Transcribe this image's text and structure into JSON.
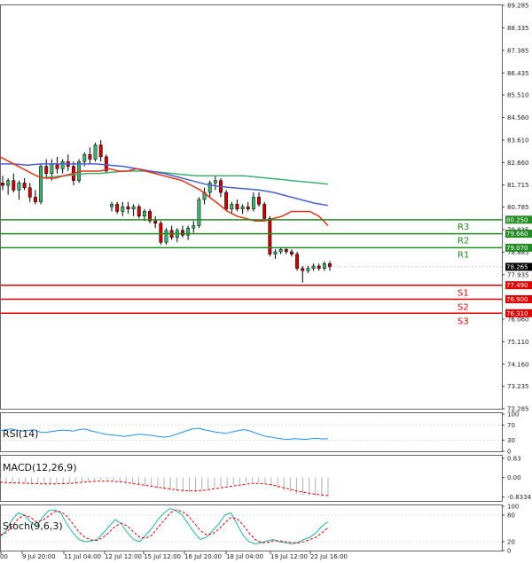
{
  "chart_data": {
    "type": "candlestick",
    "main": {
      "y_ticks": [
        "89.285",
        "88.335",
        "87.385",
        "86.435",
        "85.510",
        "84.560",
        "83.610",
        "82.660",
        "81.715",
        "80.785",
        "79.835",
        "78.885",
        "77.935",
        "76.060",
        "75.110",
        "74.160",
        "73.235",
        "72.285"
      ],
      "ylim": [
        72.285,
        89.285
      ],
      "last_price": "78.265",
      "candles": [
        {
          "o": 81.8,
          "h": 82.1,
          "l": 81.5,
          "c": 81.7
        },
        {
          "o": 81.7,
          "h": 82.0,
          "l": 81.3,
          "c": 81.9
        },
        {
          "o": 81.9,
          "h": 82.2,
          "l": 81.4,
          "c": 81.5
        },
        {
          "o": 81.5,
          "h": 81.9,
          "l": 81.1,
          "c": 81.8
        },
        {
          "o": 81.8,
          "h": 82.0,
          "l": 81.5,
          "c": 81.6
        },
        {
          "o": 81.6,
          "h": 81.8,
          "l": 81.0,
          "c": 81.2
        },
        {
          "o": 81.2,
          "h": 81.5,
          "l": 80.9,
          "c": 81.0
        },
        {
          "o": 81.0,
          "h": 82.6,
          "l": 80.9,
          "c": 82.5
        },
        {
          "o": 82.5,
          "h": 82.8,
          "l": 82.0,
          "c": 82.2
        },
        {
          "o": 82.2,
          "h": 82.8,
          "l": 81.9,
          "c": 82.6
        },
        {
          "o": 82.6,
          "h": 82.9,
          "l": 82.2,
          "c": 82.4
        },
        {
          "o": 82.4,
          "h": 82.8,
          "l": 82.2,
          "c": 82.7
        },
        {
          "o": 82.7,
          "h": 83.0,
          "l": 82.3,
          "c": 82.5
        },
        {
          "o": 82.5,
          "h": 82.7,
          "l": 81.7,
          "c": 81.9
        },
        {
          "o": 81.9,
          "h": 82.8,
          "l": 81.8,
          "c": 82.7
        },
        {
          "o": 82.7,
          "h": 83.1,
          "l": 82.5,
          "c": 83.0
        },
        {
          "o": 83.0,
          "h": 83.3,
          "l": 82.6,
          "c": 82.8
        },
        {
          "o": 82.8,
          "h": 83.5,
          "l": 82.7,
          "c": 83.4
        },
        {
          "o": 83.4,
          "h": 83.6,
          "l": 82.7,
          "c": 82.9
        },
        {
          "o": 82.9,
          "h": 83.0,
          "l": 82.2,
          "c": 82.3
        },
        {
          "o": 80.8,
          "h": 81.0,
          "l": 80.6,
          "c": 80.9
        },
        {
          "o": 80.9,
          "h": 81.0,
          "l": 80.5,
          "c": 80.6
        },
        {
          "o": 80.6,
          "h": 81.0,
          "l": 80.4,
          "c": 80.8
        },
        {
          "o": 80.8,
          "h": 81.0,
          "l": 80.5,
          "c": 80.7
        },
        {
          "o": 80.7,
          "h": 80.9,
          "l": 80.4,
          "c": 80.8
        },
        {
          "o": 80.8,
          "h": 80.9,
          "l": 80.3,
          "c": 80.4
        },
        {
          "o": 80.4,
          "h": 80.7,
          "l": 80.2,
          "c": 80.6
        },
        {
          "o": 80.6,
          "h": 80.7,
          "l": 80.1,
          "c": 80.2
        },
        {
          "o": 80.2,
          "h": 80.4,
          "l": 79.9,
          "c": 80.1
        },
        {
          "o": 80.1,
          "h": 80.2,
          "l": 79.2,
          "c": 79.3
        },
        {
          "o": 79.3,
          "h": 79.9,
          "l": 79.2,
          "c": 79.8
        },
        {
          "o": 79.8,
          "h": 80.0,
          "l": 79.4,
          "c": 79.5
        },
        {
          "o": 79.5,
          "h": 79.9,
          "l": 79.3,
          "c": 79.8
        },
        {
          "o": 79.8,
          "h": 80.0,
          "l": 79.5,
          "c": 79.6
        },
        {
          "o": 79.6,
          "h": 80.0,
          "l": 79.4,
          "c": 79.9
        },
        {
          "o": 79.9,
          "h": 80.2,
          "l": 79.7,
          "c": 80.0
        },
        {
          "o": 80.0,
          "h": 81.2,
          "l": 79.9,
          "c": 81.1
        },
        {
          "o": 81.1,
          "h": 81.6,
          "l": 80.9,
          "c": 81.4
        },
        {
          "o": 81.4,
          "h": 81.9,
          "l": 81.2,
          "c": 81.8
        },
        {
          "o": 81.8,
          "h": 82.1,
          "l": 81.5,
          "c": 81.9
        },
        {
          "o": 81.9,
          "h": 82.0,
          "l": 81.2,
          "c": 81.4
        },
        {
          "o": 81.4,
          "h": 81.5,
          "l": 80.6,
          "c": 80.7
        },
        {
          "o": 80.7,
          "h": 81.0,
          "l": 80.5,
          "c": 80.9
        },
        {
          "o": 80.9,
          "h": 81.1,
          "l": 80.6,
          "c": 80.7
        },
        {
          "o": 80.7,
          "h": 80.9,
          "l": 80.5,
          "c": 80.8
        },
        {
          "o": 80.8,
          "h": 81.0,
          "l": 80.6,
          "c": 80.7
        },
        {
          "o": 80.7,
          "h": 81.4,
          "l": 80.6,
          "c": 81.2
        },
        {
          "o": 81.2,
          "h": 81.4,
          "l": 80.8,
          "c": 80.9
        },
        {
          "o": 80.9,
          "h": 81.0,
          "l": 80.2,
          "c": 80.3
        },
        {
          "o": 80.3,
          "h": 80.4,
          "l": 78.7,
          "c": 78.8
        },
        {
          "o": 78.8,
          "h": 79.0,
          "l": 78.6,
          "c": 78.9
        },
        {
          "o": 78.9,
          "h": 79.1,
          "l": 78.8,
          "c": 79.0
        },
        {
          "o": 79.0,
          "h": 79.1,
          "l": 78.8,
          "c": 78.9
        },
        {
          "o": 78.9,
          "h": 79.0,
          "l": 78.7,
          "c": 78.8
        },
        {
          "o": 78.8,
          "h": 78.9,
          "l": 78.1,
          "c": 78.2
        },
        {
          "o": 78.2,
          "h": 78.3,
          "l": 77.6,
          "c": 78.1
        },
        {
          "o": 78.1,
          "h": 78.3,
          "l": 78.0,
          "c": 78.2
        },
        {
          "o": 78.2,
          "h": 78.4,
          "l": 78.1,
          "c": 78.3
        },
        {
          "o": 78.3,
          "h": 78.4,
          "l": 78.1,
          "c": 78.2
        },
        {
          "o": 78.2,
          "h": 78.5,
          "l": 78.1,
          "c": 78.4
        },
        {
          "o": 78.4,
          "h": 78.5,
          "l": 78.1,
          "c": 78.265
        }
      ],
      "ma_fast": [
        82.9,
        82.7,
        82.5,
        82.3,
        82.1,
        82.0,
        82.0,
        82.1,
        82.2,
        82.3,
        82.3,
        82.3,
        82.4,
        82.3,
        82.3,
        82.4,
        82.3,
        82.2,
        82.1,
        82.0,
        81.9,
        81.7,
        81.5,
        81.2,
        80.9,
        80.6,
        80.4,
        80.3,
        80.2,
        80.2,
        80.3,
        80.4,
        80.6,
        80.6,
        80.6,
        80.4,
        80.0
      ],
      "ma_mid": [
        82.6,
        82.6,
        82.55,
        82.6,
        82.6,
        82.6,
        82.6,
        82.6,
        82.55,
        82.5,
        82.4,
        82.3,
        82.2,
        82.05,
        81.9,
        81.75,
        81.65,
        81.6,
        81.55,
        81.5,
        81.4,
        81.25,
        81.1,
        80.95,
        80.85
      ],
      "ma_slow": [
        82.0,
        82.05,
        82.1,
        82.15,
        82.2,
        82.2,
        82.25,
        82.3,
        82.3,
        82.3,
        82.25,
        82.2,
        82.15,
        82.1,
        82.1,
        82.1,
        82.1,
        82.1,
        82.05,
        82.0,
        81.95,
        81.9,
        81.85,
        81.8,
        81.75
      ],
      "levels": [
        {
          "name": "R3",
          "value": "80.250",
          "kind": "resistance"
        },
        {
          "name": "R2",
          "value": "79.660",
          "kind": "resistance"
        },
        {
          "name": "R1",
          "value": "79.070",
          "kind": "resistance"
        },
        {
          "name": "S1",
          "value": "77.490",
          "kind": "support"
        },
        {
          "name": "S2",
          "value": "76.900",
          "kind": "support"
        },
        {
          "name": "S3",
          "value": "76.310",
          "kind": "support"
        }
      ]
    },
    "x_ticks": [
      "00",
      "9 Jul 20:00",
      "11 Jul 04:00",
      "12 Jul 12:00",
      "15 Jul 12:00",
      "16 Jul 20:00",
      "18 Jul 04:00",
      "19 Jul 12:00",
      "22 Jul 16:00"
    ],
    "rsi": {
      "label": "RSI(14)",
      "ticks": [
        "100",
        "70",
        "30",
        "0"
      ],
      "ylim": [
        0,
        100
      ],
      "values": [
        55,
        58,
        60,
        57,
        54,
        56,
        58,
        52,
        50,
        53,
        55,
        57,
        56,
        54,
        58,
        60,
        55,
        52,
        48,
        45,
        44,
        42,
        40,
        42,
        45,
        46,
        44,
        42,
        40,
        38,
        40,
        45,
        50,
        55,
        60,
        62,
        58,
        55,
        52,
        50,
        48,
        52,
        55,
        58,
        56,
        50,
        45,
        40,
        38,
        35,
        33,
        32,
        34,
        33,
        32,
        34,
        35,
        33,
        34
      ]
    },
    "macd": {
      "label": "MACD(12,26,9)",
      "ticks": [
        "0.83",
        "0.00",
        "-0.8334"
      ],
      "ylim": [
        -1.0,
        0.9
      ],
      "hist": [
        -0.15,
        -0.18,
        -0.2,
        -0.22,
        -0.24,
        -0.25,
        -0.26,
        -0.27,
        -0.28,
        -0.28,
        -0.27,
        -0.25,
        -0.22,
        -0.18,
        -0.15,
        -0.12,
        -0.1,
        -0.1,
        -0.12,
        -0.15,
        -0.2,
        -0.25,
        -0.3,
        -0.35,
        -0.4,
        -0.45,
        -0.5,
        -0.55,
        -0.58,
        -0.6,
        -0.62,
        -0.6,
        -0.55,
        -0.5,
        -0.45,
        -0.4,
        -0.35,
        -0.3,
        -0.25,
        -0.2,
        -0.18,
        -0.2,
        -0.25,
        -0.35,
        -0.45,
        -0.55,
        -0.62,
        -0.7,
        -0.75,
        -0.78,
        -0.8,
        -0.82,
        -0.83
      ],
      "signal": [
        -0.2,
        -0.21,
        -0.22,
        -0.23,
        -0.24,
        -0.25,
        -0.26,
        -0.27,
        -0.27,
        -0.27,
        -0.26,
        -0.25,
        -0.23,
        -0.2,
        -0.18,
        -0.16,
        -0.15,
        -0.15,
        -0.16,
        -0.18,
        -0.21,
        -0.25,
        -0.29,
        -0.33,
        -0.37,
        -0.41,
        -0.45,
        -0.49,
        -0.52,
        -0.55,
        -0.57,
        -0.57,
        -0.55,
        -0.52,
        -0.48,
        -0.44,
        -0.4,
        -0.36,
        -0.32,
        -0.28,
        -0.25,
        -0.25,
        -0.27,
        -0.31,
        -0.37,
        -0.44,
        -0.5,
        -0.57,
        -0.62,
        -0.67,
        -0.71,
        -0.74,
        -0.77
      ]
    },
    "stoch": {
      "label": "Stoch(9,6,3)",
      "ticks": [
        "100",
        "80",
        "20",
        "0"
      ],
      "ylim": [
        0,
        100
      ],
      "k": [
        30,
        45,
        70,
        85,
        80,
        65,
        55,
        75,
        90,
        92,
        85,
        60,
        40,
        25,
        20,
        22,
        25,
        40,
        55,
        70,
        60,
        40,
        25,
        20,
        35,
        50,
        70,
        85,
        95,
        90,
        80,
        60,
        40,
        25,
        30,
        45,
        60,
        80,
        85,
        60,
        35,
        20,
        15,
        18,
        22,
        25,
        20,
        18,
        15,
        18,
        25,
        30,
        40,
        55,
        65
      ],
      "d": [
        35,
        40,
        55,
        72,
        80,
        75,
        65,
        68,
        78,
        88,
        88,
        78,
        60,
        42,
        30,
        24,
        23,
        30,
        42,
        55,
        62,
        55,
        42,
        30,
        28,
        35,
        52,
        68,
        85,
        92,
        88,
        78,
        62,
        45,
        35,
        38,
        48,
        62,
        75,
        72,
        58,
        40,
        25,
        18,
        18,
        22,
        22,
        20,
        18,
        17,
        20,
        25,
        30,
        40,
        52
      ]
    }
  }
}
